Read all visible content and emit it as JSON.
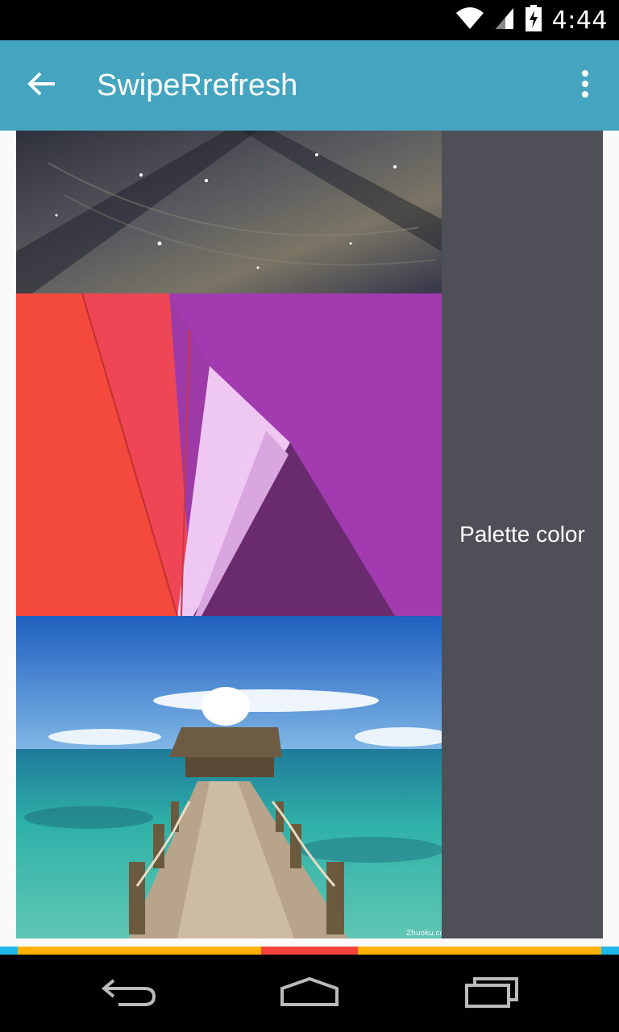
{
  "status_bar": {
    "time": "4:44",
    "icons": [
      "wifi-icon",
      "cell-signal-icon",
      "battery-charging-icon"
    ]
  },
  "app_bar": {
    "title": "SwipeRrefresh",
    "back_icon": "arrow-back-icon",
    "overflow_icon": "more-vert-icon",
    "color": "#45a5c0"
  },
  "list": {
    "images": [
      {
        "name": "wood-planks-image"
      },
      {
        "name": "material-abstract-image"
      },
      {
        "name": "beach-pier-image",
        "watermark": "Zhuoku.com"
      }
    ],
    "palette": {
      "label": "Palette color",
      "color": "#4f4f58"
    }
  },
  "refresh_indicator": {
    "colors": [
      "#1fb8e8",
      "#ffb300",
      "#f4433c",
      "#ffb300",
      "#1fb8e8"
    ]
  },
  "nav_bar": {
    "buttons": [
      "back-nav-icon",
      "home-nav-icon",
      "recents-nav-icon"
    ]
  }
}
